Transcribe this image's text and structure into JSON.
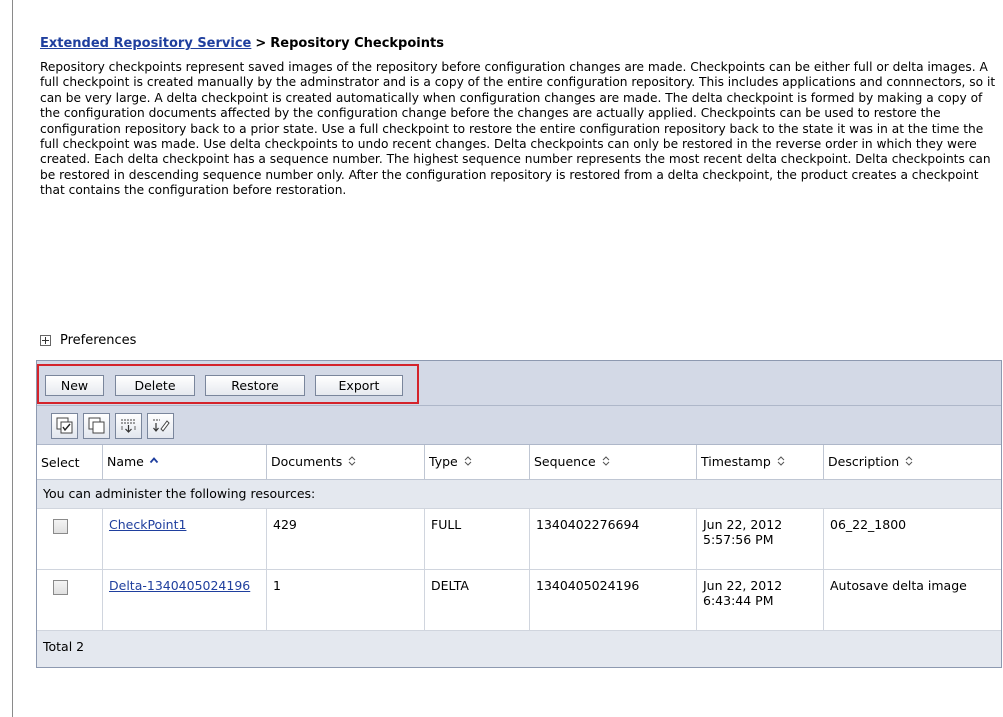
{
  "breadcrumb": {
    "parent": "Extended Repository Service",
    "separator": ">",
    "current": "Repository Checkpoints"
  },
  "description": "Repository checkpoints represent saved images of the repository before configuration changes are made. Checkpoints can be either full or delta images. A full checkpoint is created manually by the adminstrator and is a copy of the entire configuration repository. This includes applications and connnectors, so it can be very large. A delta checkpoint is created automatically when configuration changes are made. The delta checkpoint is formed by making a copy of the configuration documents affected by the configuration change before the changes are actually applied. Checkpoints can be used to restore the configuration repository back to a prior state. Use a full checkpoint to restore the entire configuration repository back to the state it was in at the time the full checkpoint was made. Use delta checkpoints to undo recent changes. Delta checkpoints can only be restored in the reverse order in which they were created. Each delta checkpoint has a sequence number. The highest sequence number represents the most recent delta checkpoint. Delta checkpoints can be restored in descending sequence number only. After the configuration repository is restored from a delta checkpoint, the product creates a checkpoint that contains the configuration before restoration.",
  "preferences_label": "Preferences",
  "toolbar": {
    "new_label": "New",
    "delete_label": "Delete",
    "restore_label": "Restore",
    "export_label": "Export",
    "icons": [
      "select-all-icon",
      "deselect-all-icon",
      "show-filter-icon",
      "clear-filter-icon"
    ]
  },
  "table": {
    "columns": {
      "select": "Select",
      "name": "Name",
      "documents": "Documents",
      "type": "Type",
      "sequence": "Sequence",
      "timestamp": "Timestamp",
      "description": "Description"
    },
    "section_label": "You can administer the following resources:",
    "rows": [
      {
        "name": "CheckPoint1",
        "documents": "429",
        "type": "FULL",
        "sequence": "1340402276694",
        "timestamp": "Jun 22, 2012 5:57:56 PM",
        "description": "06_22_1800"
      },
      {
        "name": "Delta-1340405024196",
        "documents": "1",
        "type": "DELTA",
        "sequence": "1340405024196",
        "timestamp": "Jun 22, 2012 6:43:44 PM",
        "description": "Autosave delta image"
      }
    ],
    "total": "Total 2"
  },
  "colors": {
    "link": "#1f3f9e",
    "toolbar_bg": "#d3d9e6",
    "highlight_border": "#d4232b",
    "row_band": "#e4e8ef"
  }
}
